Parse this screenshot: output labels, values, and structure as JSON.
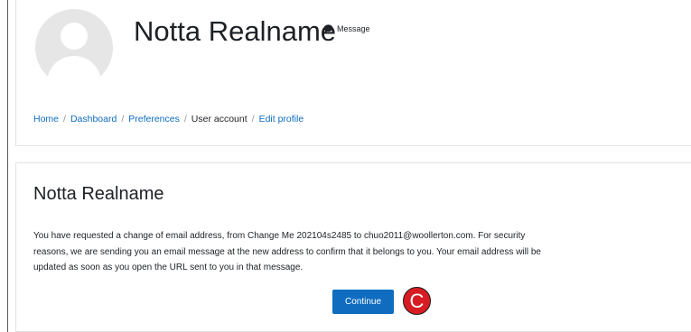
{
  "header": {
    "profile_name": "Notta Realname",
    "message_label": "Message"
  },
  "breadcrumb": {
    "items": [
      {
        "label": "Home",
        "link": true
      },
      {
        "label": "Dashboard",
        "link": true
      },
      {
        "label": "Preferences",
        "link": true
      },
      {
        "label": "User account",
        "link": false
      },
      {
        "label": "Edit profile",
        "link": true
      }
    ],
    "separator": "/"
  },
  "content": {
    "title": "Notta Realname",
    "message_lines": [
      "You have requested a change of email address, from Change Me 202104s2485 to chuo2011@woollerton.com. For security",
      "reasons, we are sending you an email message at the new address to confirm that it belongs to you. Your email address will be",
      "updated as soon as you open the URL sent to you in that message."
    ],
    "continue_label": "Continue"
  },
  "callout": {
    "letter": "C",
    "color": "#d71d24"
  },
  "colors": {
    "link": "#0f6cbf",
    "primary_button": "#0f6cbf",
    "text": "#1d2125"
  },
  "icons": {
    "message": "speech-bubble-icon",
    "avatar": "default-user-avatar-icon"
  }
}
